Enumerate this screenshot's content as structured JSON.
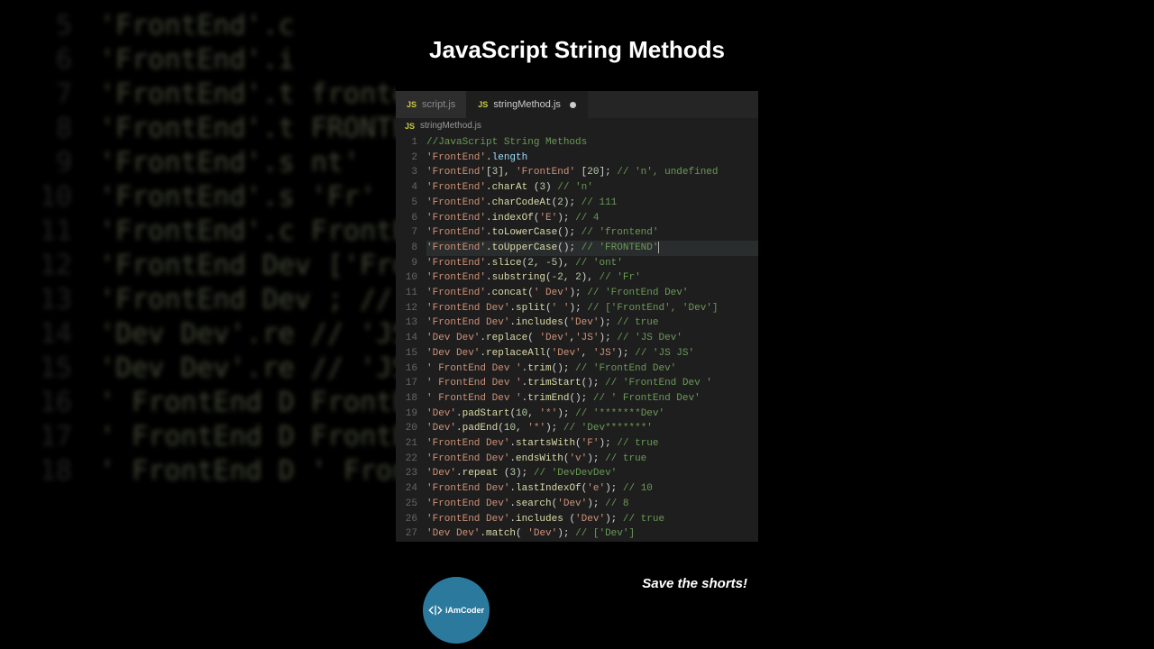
{
  "title": "JavaScript String Methods",
  "tabs": [
    {
      "label": "script.js",
      "active": false,
      "modified": false
    },
    {
      "label": "stringMethod.js",
      "active": true,
      "modified": true
    }
  ],
  "breadcrumb": "stringMethod.js",
  "save_text": "Save the shorts!",
  "badge_text": "iAmCoder",
  "code": {
    "active_line": 8,
    "lines": [
      {
        "n": 1,
        "tokens": [
          [
            "cm",
            "//JavaScript String Methods"
          ]
        ]
      },
      {
        "n": 2,
        "tokens": [
          [
            "st",
            "'FrontEnd'"
          ],
          [
            "pn",
            "."
          ],
          [
            "pr",
            "length"
          ]
        ]
      },
      {
        "n": 3,
        "tokens": [
          [
            "st",
            "'FrontEnd'"
          ],
          [
            "pn",
            "["
          ],
          [
            "nm",
            "3"
          ],
          [
            "pn",
            "], "
          ],
          [
            "st",
            "'FrontEnd'"
          ],
          [
            "pn",
            " ["
          ],
          [
            "nm",
            "20"
          ],
          [
            "pn",
            "]; "
          ],
          [
            "cm",
            "// 'n', undefined"
          ]
        ]
      },
      {
        "n": 4,
        "tokens": [
          [
            "st",
            "'FrontEnd'"
          ],
          [
            "pn",
            "."
          ],
          [
            "fn",
            "charAt"
          ],
          [
            "pn",
            " ("
          ],
          [
            "nm",
            "3"
          ],
          [
            "pn",
            ") "
          ],
          [
            "cm",
            "// 'n'"
          ]
        ]
      },
      {
        "n": 5,
        "tokens": [
          [
            "st",
            "'FrontEnd'"
          ],
          [
            "pn",
            "."
          ],
          [
            "fn",
            "charCodeAt"
          ],
          [
            "pn",
            "("
          ],
          [
            "nm",
            "2"
          ],
          [
            "pn",
            "); "
          ],
          [
            "cm",
            "// 111"
          ]
        ]
      },
      {
        "n": 6,
        "tokens": [
          [
            "st",
            "'FrontEnd'"
          ],
          [
            "pn",
            "."
          ],
          [
            "fn",
            "indexOf"
          ],
          [
            "pn",
            "("
          ],
          [
            "st",
            "'E'"
          ],
          [
            "pn",
            "); "
          ],
          [
            "cm",
            "// 4"
          ]
        ]
      },
      {
        "n": 7,
        "tokens": [
          [
            "st",
            "'FrontEnd'"
          ],
          [
            "pn",
            "."
          ],
          [
            "fn",
            "toLowerCase"
          ],
          [
            "pn",
            "(); "
          ],
          [
            "cm",
            "// 'frontend'"
          ]
        ]
      },
      {
        "n": 8,
        "tokens": [
          [
            "st",
            "'FrontEnd'"
          ],
          [
            "pn",
            "."
          ],
          [
            "fn",
            "toUpperCase"
          ],
          [
            "pn",
            "(); "
          ],
          [
            "cm",
            "// 'FRONTEND'"
          ]
        ]
      },
      {
        "n": 9,
        "tokens": [
          [
            "st",
            "'FrontEnd'"
          ],
          [
            "pn",
            "."
          ],
          [
            "fn",
            "slice"
          ],
          [
            "pn",
            "("
          ],
          [
            "nm",
            "2"
          ],
          [
            "pn",
            ", "
          ],
          [
            "nm",
            "-5"
          ],
          [
            "pn",
            "), "
          ],
          [
            "cm",
            "// 'ont'"
          ]
        ]
      },
      {
        "n": 10,
        "tokens": [
          [
            "st",
            "'FrontEnd'"
          ],
          [
            "pn",
            "."
          ],
          [
            "fn",
            "substring"
          ],
          [
            "pn",
            "("
          ],
          [
            "nm",
            "-2"
          ],
          [
            "pn",
            ", "
          ],
          [
            "nm",
            "2"
          ],
          [
            "pn",
            "), "
          ],
          [
            "cm",
            "// 'Fr'"
          ]
        ]
      },
      {
        "n": 11,
        "tokens": [
          [
            "st",
            "'FrontEnd'"
          ],
          [
            "pn",
            "."
          ],
          [
            "fn",
            "concat"
          ],
          [
            "pn",
            "("
          ],
          [
            "st",
            "' Dev'"
          ],
          [
            "pn",
            "); "
          ],
          [
            "cm",
            "// 'FrontEnd Dev'"
          ]
        ]
      },
      {
        "n": 12,
        "tokens": [
          [
            "st",
            "'FrontEnd Dev'"
          ],
          [
            "pn",
            "."
          ],
          [
            "fn",
            "split"
          ],
          [
            "pn",
            "("
          ],
          [
            "st",
            "' '"
          ],
          [
            "pn",
            "); "
          ],
          [
            "cm",
            "// ['FrontEnd', 'Dev']"
          ]
        ]
      },
      {
        "n": 13,
        "tokens": [
          [
            "st",
            "'FrontEnd Dev'"
          ],
          [
            "pn",
            "."
          ],
          [
            "fn",
            "includes"
          ],
          [
            "pn",
            "("
          ],
          [
            "st",
            "'Dev'"
          ],
          [
            "pn",
            "); "
          ],
          [
            "cm",
            "// true"
          ]
        ]
      },
      {
        "n": 14,
        "tokens": [
          [
            "st",
            "'Dev Dev'"
          ],
          [
            "pn",
            "."
          ],
          [
            "fn",
            "replace"
          ],
          [
            "pn",
            "( "
          ],
          [
            "st",
            "'Dev'"
          ],
          [
            "pn",
            ","
          ],
          [
            "st",
            "'JS'"
          ],
          [
            "pn",
            "); "
          ],
          [
            "cm",
            "// 'JS Dev'"
          ]
        ]
      },
      {
        "n": 15,
        "tokens": [
          [
            "st",
            "'Dev Dev'"
          ],
          [
            "pn",
            "."
          ],
          [
            "fn",
            "replaceAll"
          ],
          [
            "pn",
            "("
          ],
          [
            "st",
            "'Dev'"
          ],
          [
            "pn",
            ", "
          ],
          [
            "st",
            "'JS'"
          ],
          [
            "pn",
            "); "
          ],
          [
            "cm",
            "// 'JS JS'"
          ]
        ]
      },
      {
        "n": 16,
        "tokens": [
          [
            "st",
            "' FrontEnd Dev '"
          ],
          [
            "pn",
            "."
          ],
          [
            "fn",
            "trim"
          ],
          [
            "pn",
            "(); "
          ],
          [
            "cm",
            "// 'FrontEnd Dev'"
          ]
        ]
      },
      {
        "n": 17,
        "tokens": [
          [
            "st",
            "' FrontEnd Dev '"
          ],
          [
            "pn",
            "."
          ],
          [
            "fn",
            "trimStart"
          ],
          [
            "pn",
            "(); "
          ],
          [
            "cm",
            "// 'FrontEnd Dev '"
          ]
        ]
      },
      {
        "n": 18,
        "tokens": [
          [
            "st",
            "' FrontEnd Dev '"
          ],
          [
            "pn",
            "."
          ],
          [
            "fn",
            "trimEnd"
          ],
          [
            "pn",
            "(); "
          ],
          [
            "cm",
            "// ' FrontEnd Dev'"
          ]
        ]
      },
      {
        "n": 19,
        "tokens": [
          [
            "st",
            "'Dev'"
          ],
          [
            "pn",
            "."
          ],
          [
            "fn",
            "padStart"
          ],
          [
            "pn",
            "("
          ],
          [
            "nm",
            "10"
          ],
          [
            "pn",
            ", "
          ],
          [
            "st",
            "'*'"
          ],
          [
            "pn",
            "); "
          ],
          [
            "cm",
            "// '*******Dev'"
          ]
        ]
      },
      {
        "n": 20,
        "tokens": [
          [
            "st",
            "'Dev'"
          ],
          [
            "pn",
            "."
          ],
          [
            "fn",
            "padEnd"
          ],
          [
            "pn",
            "("
          ],
          [
            "nm",
            "10"
          ],
          [
            "pn",
            ", "
          ],
          [
            "st",
            "'*'"
          ],
          [
            "pn",
            "); "
          ],
          [
            "cm",
            "// 'Dev*******'"
          ]
        ]
      },
      {
        "n": 21,
        "tokens": [
          [
            "st",
            "'FrontEnd Dev'"
          ],
          [
            "pn",
            "."
          ],
          [
            "fn",
            "startsWith"
          ],
          [
            "pn",
            "("
          ],
          [
            "st",
            "'F'"
          ],
          [
            "pn",
            "); "
          ],
          [
            "cm",
            "// true"
          ]
        ]
      },
      {
        "n": 22,
        "tokens": [
          [
            "st",
            "'FrontEnd Dev'"
          ],
          [
            "pn",
            "."
          ],
          [
            "fn",
            "endsWith"
          ],
          [
            "pn",
            "("
          ],
          [
            "st",
            "'v'"
          ],
          [
            "pn",
            "); "
          ],
          [
            "cm",
            "// true"
          ]
        ]
      },
      {
        "n": 23,
        "tokens": [
          [
            "st",
            "'Dev'"
          ],
          [
            "pn",
            "."
          ],
          [
            "fn",
            "repeat"
          ],
          [
            "pn",
            " ("
          ],
          [
            "nm",
            "3"
          ],
          [
            "pn",
            "); "
          ],
          [
            "cm",
            "// 'DevDevDev'"
          ]
        ]
      },
      {
        "n": 24,
        "tokens": [
          [
            "st",
            "'FrontEnd Dev'"
          ],
          [
            "pn",
            "."
          ],
          [
            "fn",
            "lastIndexOf"
          ],
          [
            "pn",
            "("
          ],
          [
            "st",
            "'e'"
          ],
          [
            "pn",
            "); "
          ],
          [
            "cm",
            "// 10"
          ]
        ]
      },
      {
        "n": 25,
        "tokens": [
          [
            "st",
            "'FrontEnd Dev'"
          ],
          [
            "pn",
            "."
          ],
          [
            "fn",
            "search"
          ],
          [
            "pn",
            "("
          ],
          [
            "st",
            "'Dev'"
          ],
          [
            "pn",
            "); "
          ],
          [
            "cm",
            "// 8"
          ]
        ]
      },
      {
        "n": 26,
        "tokens": [
          [
            "st",
            "'FrontEnd Dev'"
          ],
          [
            "pn",
            "."
          ],
          [
            "fn",
            "includes"
          ],
          [
            "pn",
            " ("
          ],
          [
            "st",
            "'Dev'"
          ],
          [
            "pn",
            "); "
          ],
          [
            "cm",
            "// true"
          ]
        ]
      },
      {
        "n": 27,
        "tokens": [
          [
            "st",
            "'Dev Dev'"
          ],
          [
            "pn",
            "."
          ],
          [
            "fn",
            "match"
          ],
          [
            "pn",
            "( "
          ],
          [
            "st",
            "'Dev'"
          ],
          [
            "pn",
            "); "
          ],
          [
            "cm",
            "// ['Dev']"
          ]
        ]
      }
    ]
  },
  "blur_lines": [
    {
      "n": 5,
      "txt": "'FrontEnd'.c"
    },
    {
      "n": 6,
      "txt": "'FrontEnd'.i"
    },
    {
      "n": 7,
      "txt": "'FrontEnd'.t                    frontend'"
    },
    {
      "n": 8,
      "txt": "'FrontEnd'.t                    FRONTEND'"
    },
    {
      "n": 9,
      "txt": "'FrontEnd'.s                  nt'"
    },
    {
      "n": 10,
      "txt": "'FrontEnd'.s                       'Fr'"
    },
    {
      "n": 11,
      "txt": "'FrontEnd'.c                    FrontEnd Dev'"
    },
    {
      "n": 12,
      "txt": "'FrontEnd Dev                 ['FrontEnd', 'Dev']"
    },
    {
      "n": 13,
      "txt": "'FrontEnd Dev                 ; // true"
    },
    {
      "n": 14,
      "txt": "'Dev Dev'.re                    // 'JS Dev'"
    },
    {
      "n": 15,
      "txt": "'Dev Dev'.re                    // 'JS JS'"
    },
    {
      "n": 16,
      "txt": "' FrontEnd D                  FrontEnd Dev'"
    },
    {
      "n": 17,
      "txt": "' FrontEnd D                FrontEnd Dev '"
    },
    {
      "n": 18,
      "txt": "' FrontEnd D                 ' FrontEnd Dev'"
    }
  ]
}
